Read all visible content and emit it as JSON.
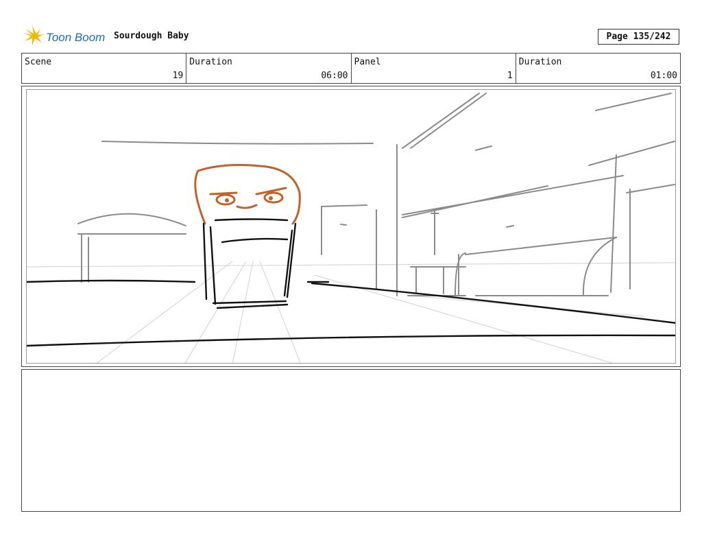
{
  "header": {
    "logo_text": "Toon Boom",
    "project_title": "Sourdough Baby",
    "page_label": "Page 135/242"
  },
  "info": {
    "scene_label": "Scene",
    "scene_value": "19",
    "scene_duration_label": "Duration",
    "scene_duration_value": "06:00",
    "panel_label": "Panel",
    "panel_value": "1",
    "panel_duration_label": "Duration",
    "panel_duration_value": "01:00"
  },
  "colors": {
    "logo_yellow": "#f5b800",
    "logo_blue": "#1a6fb5",
    "character_orange": "#c0622a",
    "sketch_gray": "#8a8a8a",
    "ink_black": "#111111"
  },
  "panel": {
    "image": "storyboard-sketch-bread-character-street"
  },
  "notes": {
    "text": ""
  }
}
